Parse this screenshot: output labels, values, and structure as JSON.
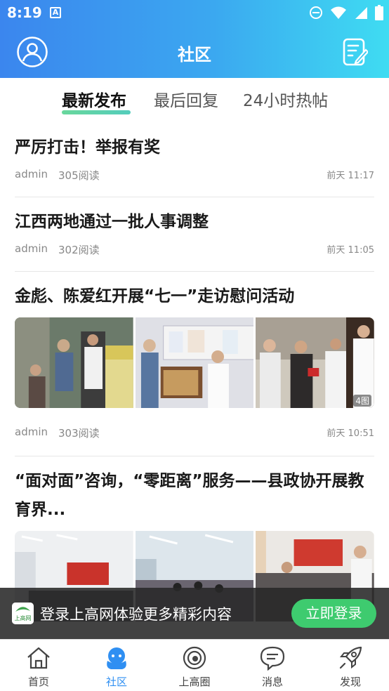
{
  "status_bar": {
    "time": "8:19",
    "a_icon": "A"
  },
  "header": {
    "title": "社区"
  },
  "tabs": [
    {
      "label": "最新发布",
      "active": true
    },
    {
      "label": "最后回复",
      "active": false
    },
    {
      "label": "24小时热帖",
      "active": false
    }
  ],
  "posts": [
    {
      "title": "严厉打击！举报有奖",
      "author": "admin",
      "reads": "305阅读",
      "time": "前天 11:17"
    },
    {
      "title": "江西两地通过一批人事调整",
      "author": "admin",
      "reads": "302阅读",
      "time": "前天 11:05"
    },
    {
      "title": "金彪、陈爱红开展“七一”走访慰问活动",
      "author": "admin",
      "reads": "303阅读",
      "time": "前天 10:51",
      "image_count": "4图"
    },
    {
      "title": "“面对面”咨询，“零距离”服务——县政协开展教育界..."
    }
  ],
  "login_banner": {
    "logo_text": "上高网",
    "text": "登录上高网体验更多精彩内容",
    "button": "立即登录"
  },
  "bottom_nav": [
    {
      "label": "首页",
      "icon": "home-icon"
    },
    {
      "label": "社区",
      "icon": "community-icon",
      "active": true
    },
    {
      "label": "上高圈",
      "icon": "circle-icon"
    },
    {
      "label": "消息",
      "icon": "message-icon"
    },
    {
      "label": "发现",
      "icon": "rocket-icon"
    }
  ],
  "colors": {
    "header_start": "#3b86ee",
    "header_end": "#3fdcf2",
    "accent": "#2f8ff2",
    "login_button": "#3ecb6f"
  }
}
